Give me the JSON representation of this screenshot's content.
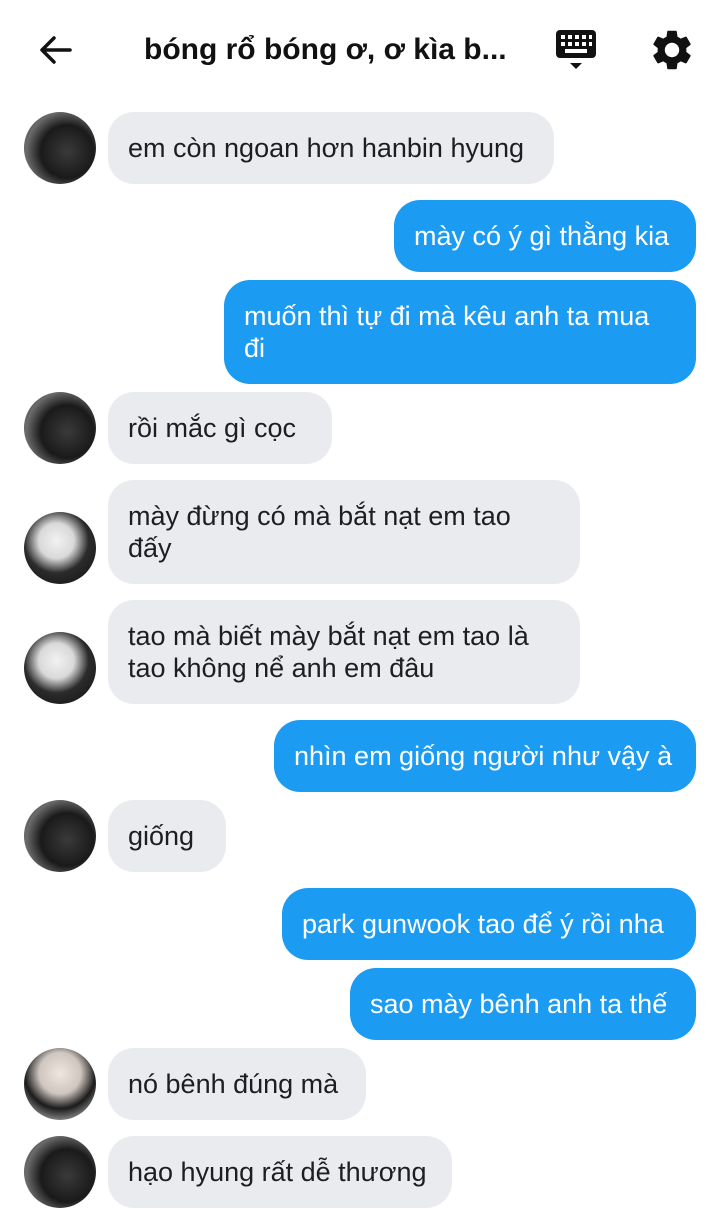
{
  "header": {
    "title": "bóng rổ bóng ơ, ơ kìa b..."
  },
  "messages": [
    {
      "text": "em còn ngoan hơn hanbin hyung"
    },
    {
      "text": "mày có ý gì thằng kia"
    },
    {
      "text": "muốn thì tự đi mà kêu anh ta mua đi"
    },
    {
      "text": "rồi mắc gì cọc"
    },
    {
      "text": "mày đừng có mà bắt nạt em tao đấy"
    },
    {
      "text": "tao mà biết mày bắt nạt em tao là tao không nể anh em đâu"
    },
    {
      "text": "nhìn em giống người như vậy à"
    },
    {
      "text": "giống"
    },
    {
      "text": "park gunwook tao để ý rồi nha"
    },
    {
      "text": "sao mày bênh anh ta thế"
    },
    {
      "text": "nó bênh đúng mà"
    },
    {
      "text": "hạo hyung rất dễ thương"
    }
  ]
}
